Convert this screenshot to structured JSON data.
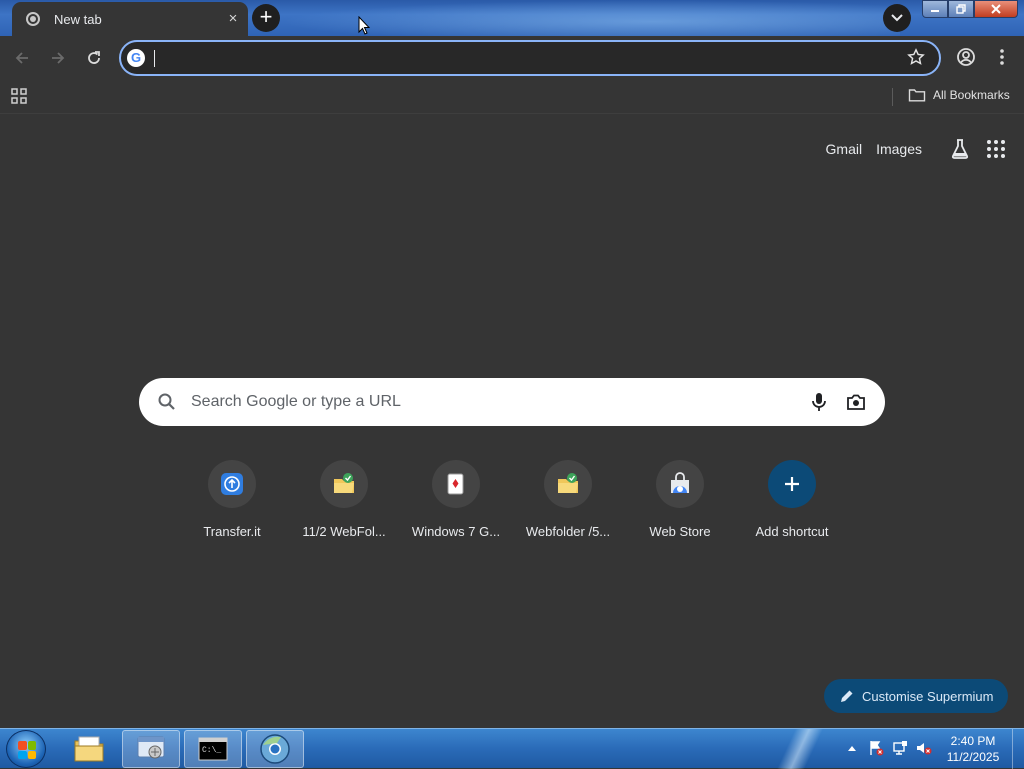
{
  "browser": {
    "tab": {
      "title": "New tab",
      "close": "×"
    },
    "new_tab": "+",
    "omnibox": {
      "value": "",
      "placeholder": ""
    },
    "bookmarks": {
      "all_bookmarks": "All Bookmarks"
    }
  },
  "ntp": {
    "links": {
      "gmail": "Gmail",
      "images": "Images"
    },
    "search_placeholder": "Search Google or type a URL",
    "shortcuts": [
      {
        "label": "Transfer.it",
        "icon": "transfer-icon"
      },
      {
        "label": "11/2 WebFol...",
        "icon": "webfolder-icon"
      },
      {
        "label": "Windows 7 G...",
        "icon": "cards-icon"
      },
      {
        "label": "Webfolder /5...",
        "icon": "webfolder-icon"
      },
      {
        "label": "Web Store",
        "icon": "webstore-icon"
      },
      {
        "label": "Add shortcut",
        "icon": "plus-icon"
      }
    ],
    "customise": "Customise Supermium"
  },
  "taskbar": {
    "clock": {
      "time": "2:40 PM",
      "date": "11/2/2025"
    }
  },
  "colors": {
    "page_bg": "#353535",
    "accent_blue": "#8ab4f8",
    "customise_bg": "#0c4a77"
  }
}
